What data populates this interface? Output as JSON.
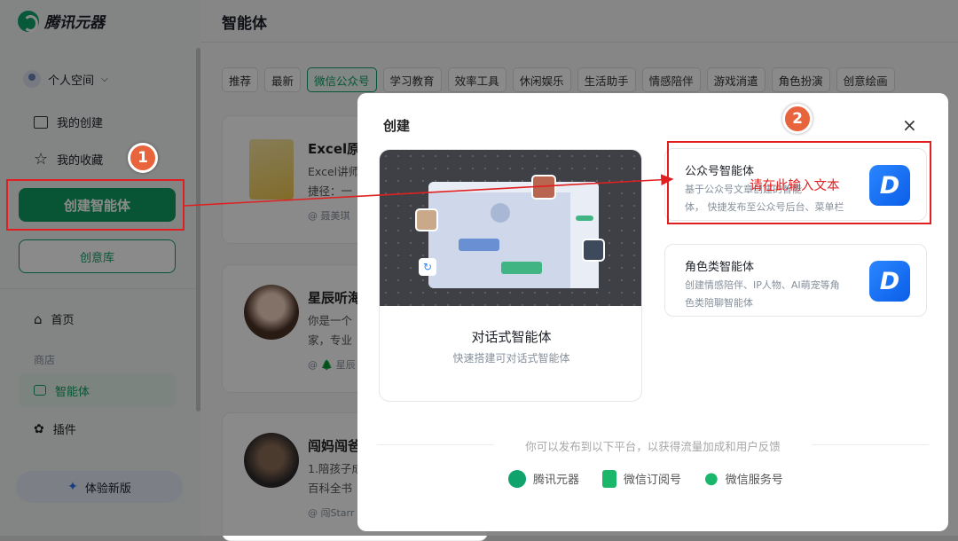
{
  "app": {
    "name": "腾讯元器"
  },
  "sidebar": {
    "space_label": "个人空间",
    "my_creations": "我的创建",
    "my_favorites": "我的收藏",
    "create_button": "创建智能体",
    "idea_button": "创意库",
    "home": "首页",
    "store_section": "商店",
    "agents": "智能体",
    "plugins": "插件",
    "try_new": "体验新版"
  },
  "header": {
    "title": "智能体"
  },
  "tabs": [
    "推荐",
    "最新",
    "微信公众号",
    "学习教育",
    "效率工具",
    "休闲娱乐",
    "生活助手",
    "情感陪伴",
    "游戏消遣",
    "角色扮演",
    "创意绘画"
  ],
  "active_tab": "微信公众号",
  "cards": [
    {
      "title": "Excel原",
      "desc1": "Excel讲师",
      "desc2": "捷径：一",
      "author": "@ 聂美琪"
    },
    {
      "title": "星辰听海",
      "desc1": "你是一个",
      "desc2": "家，专业",
      "author": "@ 🌲 星辰"
    },
    {
      "title": "闯妈闯爸",
      "desc1": "1.陪孩子成",
      "desc2": "百科全书",
      "author": "@ 闯Starr"
    }
  ],
  "modal": {
    "title": "创建",
    "close": "×",
    "chat_agent": {
      "title": "对话式智能体",
      "desc": "快速搭建可对话式智能体"
    },
    "options": [
      {
        "title": "公众号智能体",
        "desc": "基于公众号文章创建的智能体， 快捷发布至公众号后台、菜单栏",
        "desc_line1": "基于公众号文章创建的智能",
        "desc_line2": "体， 快捷发布至公众号后台、菜单栏",
        "logo": "D"
      },
      {
        "title": "角色类智能体",
        "desc": "创建情感陪伴、IP人物、AI萌宠等角色类陪聊智能体",
        "desc_line1": "创建情感陪伴、IP人物、AI萌宠等角",
        "desc_line2": "色类陪聊智能体",
        "logo": "D"
      }
    ],
    "publish_text": "你可以发布到以下平台，以获得流量加成和用户反馈",
    "platforms": [
      "腾讯元器",
      "微信订阅号",
      "微信服务号"
    ]
  },
  "annotations": {
    "badge1": "1",
    "badge2": "2",
    "hint": "请在此输入文本"
  },
  "colors": {
    "accent": "#109e64",
    "annotation": "#e02020",
    "badge": "#e8643c",
    "logo_blue": "#1b74f5"
  }
}
